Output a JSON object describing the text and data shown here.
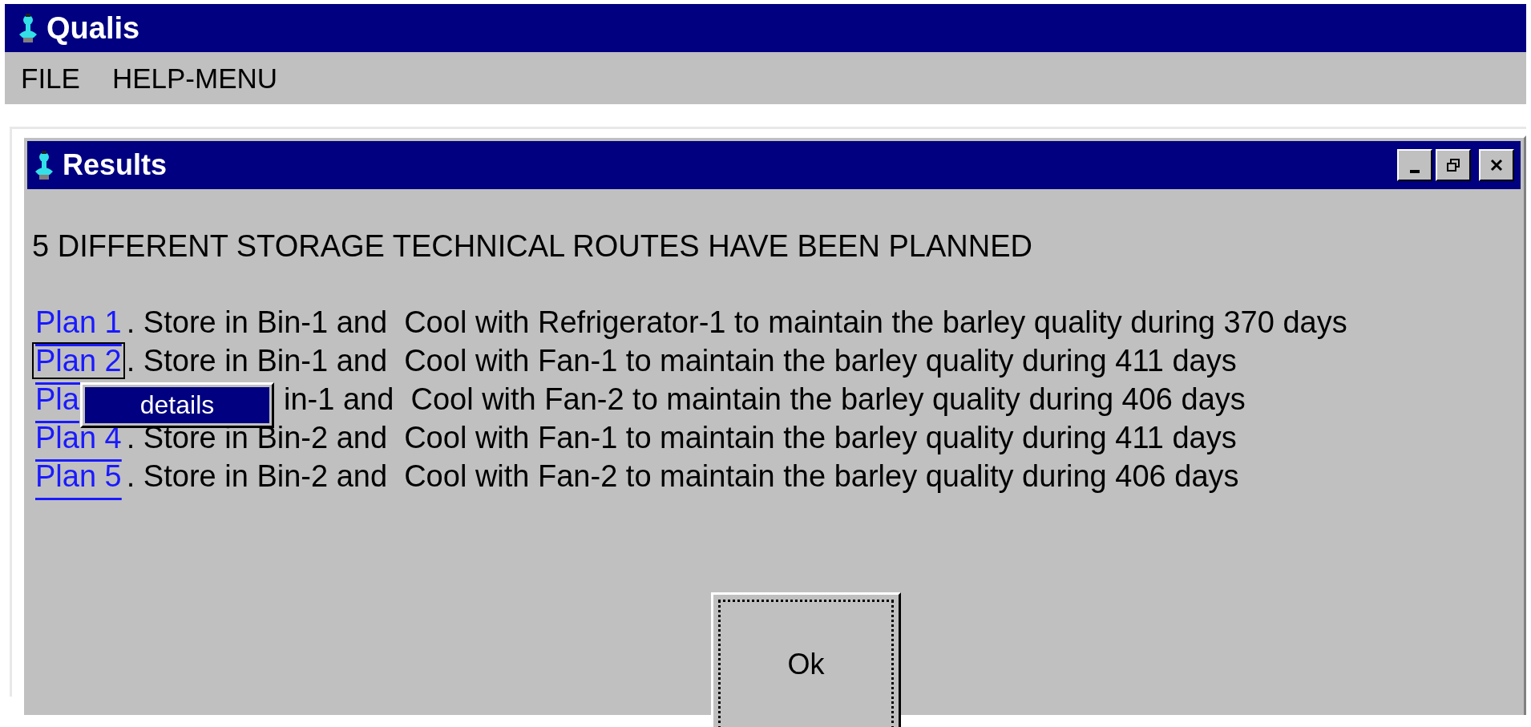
{
  "app": {
    "title": "Qualis"
  },
  "menu": [
    {
      "label": "FILE"
    },
    {
      "label": "HELP-MENU"
    }
  ],
  "dialog": {
    "title": "Results",
    "heading": "5 DIFFERENT STORAGE TECHNICAL ROUTES HAVE BEEN PLANNED",
    "plans": [
      {
        "kind": "full",
        "link": "Plan 1",
        "text": ". Store in Bin-1 and  Cool with Refrigerator-1 to maintain the barley quality during 370 days",
        "focused": false
      },
      {
        "kind": "full",
        "link": "Plan 2",
        "text": ". Store in Bin-1 and  Cool with Fan-1 to maintain the barley quality during 411 days",
        "focused": true
      },
      {
        "kind": "covered",
        "link": "Pla",
        "text": "in-1 and  Cool with Fan-2 to maintain the barley quality during 406 days",
        "focused": false
      },
      {
        "kind": "full",
        "link": "Plan 4",
        "text": ". Store in Bin-2 and  Cool with Fan-1 to maintain the barley quality during 411 days",
        "focused": false
      },
      {
        "kind": "full",
        "link": "Plan 5",
        "text": ". Store in Bin-2 and  Cool with Fan-2 to maintain the barley quality during 406 days",
        "focused": false
      }
    ],
    "context_menu": [
      {
        "label": "details",
        "selected": true
      }
    ],
    "ok_button": "Ok"
  }
}
